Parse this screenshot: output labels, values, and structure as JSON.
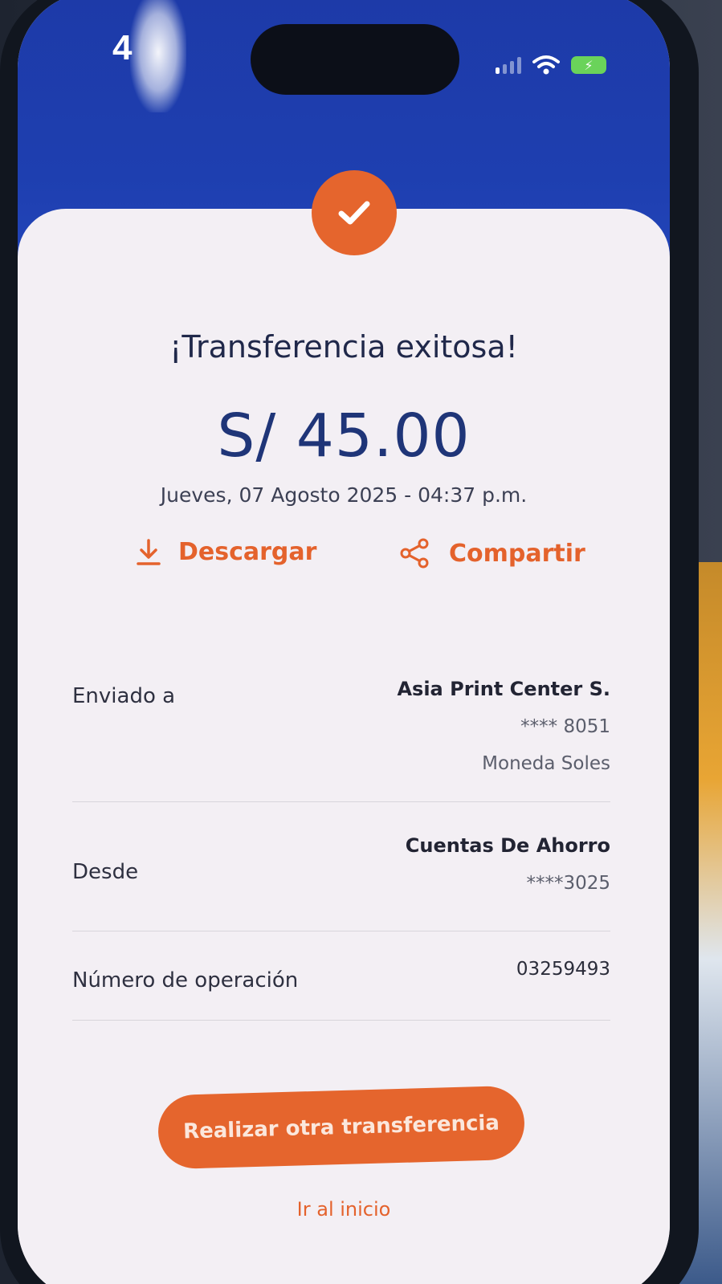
{
  "status_bar": {
    "time": "4",
    "battery_symbol": "⚡"
  },
  "icons": {
    "success": "check-icon",
    "download": "download-icon",
    "share": "share-icon"
  },
  "colors": {
    "brand_blue": "#1d3aa8",
    "accent_orange": "#e5652d",
    "amount_blue": "#1f3578"
  },
  "receipt": {
    "title": "¡Transferencia exitosa!",
    "amount": "S/ 45.00",
    "datetime": "Jueves, 07 Agosto 2025 - 04:37 p.m."
  },
  "actions": {
    "download_label": "Descargar",
    "share_label": "Compartir"
  },
  "details": [
    {
      "label": "Enviado a",
      "values": [
        "Asia Print Center S.",
        "**** 8051",
        "Moneda Soles"
      ]
    },
    {
      "label": "Desde",
      "values": [
        "Cuentas De Ahorro",
        "****3025"
      ]
    },
    {
      "label": "Número de operación",
      "values": [
        "03259493"
      ]
    }
  ],
  "buttons": {
    "primary": "Realizar otra transferencia",
    "secondary": "Ir al inicio"
  }
}
